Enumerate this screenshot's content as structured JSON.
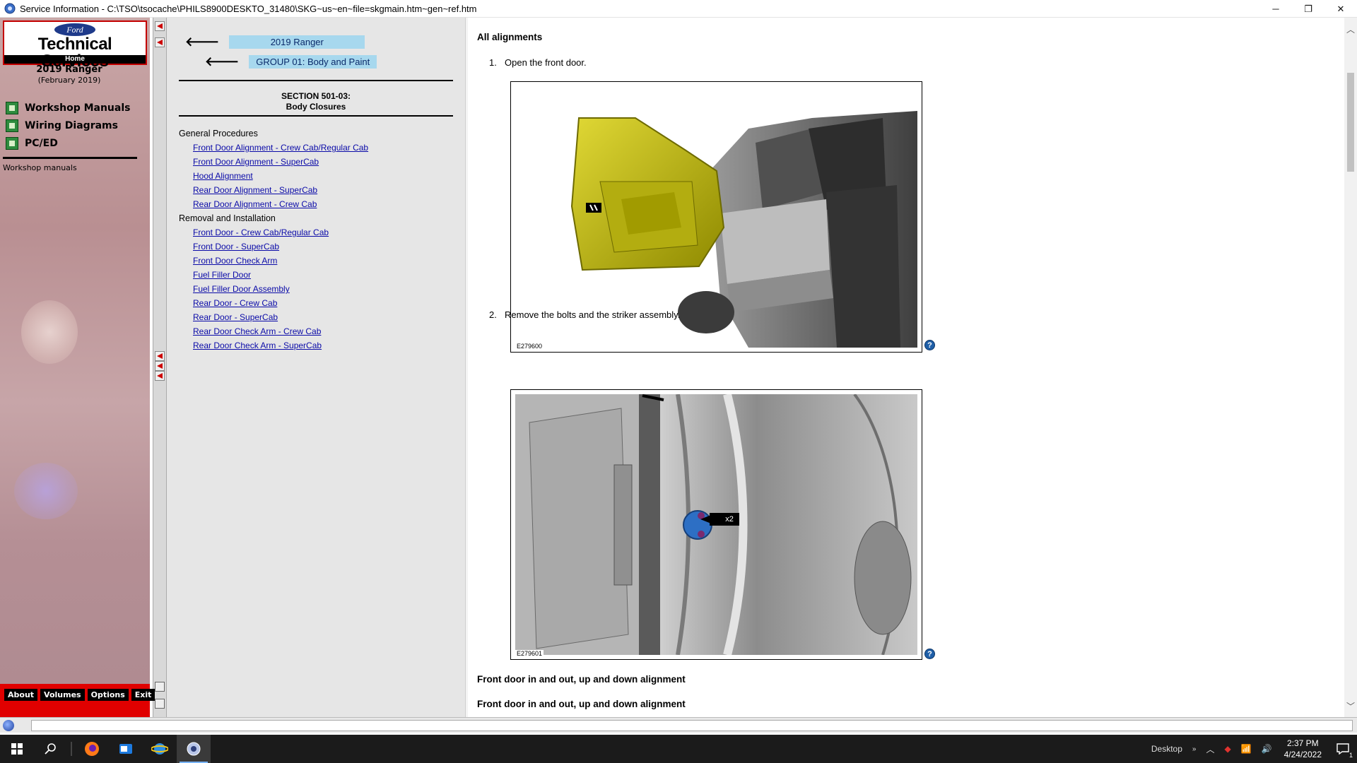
{
  "window": {
    "title": "Service Information - C:\\TSO\\tsocache\\PHILS8900DESKTO_31480\\SKG~us~en~file=skgmain.htm~gen~ref.htm",
    "minimize": "─",
    "restore": "❐",
    "close": "✕"
  },
  "sidebar": {
    "brand": {
      "logo_text": "Ford",
      "title": "Technical Services",
      "home": "Home"
    },
    "vehicle_name": "2019 Ranger",
    "vehicle_date": "(February 2019)",
    "nav_items": [
      {
        "label": "Workshop Manuals",
        "icon": "manual-icon"
      },
      {
        "label": "Wiring Diagrams",
        "icon": "wiring-icon"
      },
      {
        "label": "PC/ED",
        "icon": "pced-icon"
      }
    ],
    "caption": "Workshop manuals",
    "bottom_buttons": [
      "About",
      "Volumes",
      "Options",
      "Exit"
    ]
  },
  "toc": {
    "crumb_vehicle": "2019 Ranger",
    "crumb_group": "GROUP 01: Body and Paint",
    "section_code": "SECTION 501-03:",
    "section_name": "Body Closures",
    "categories": [
      {
        "name": "General Procedures",
        "links": [
          "Front Door Alignment - Crew Cab/Regular Cab",
          "Front Door Alignment - SuperCab",
          "Hood Alignment",
          "Rear Door Alignment - SuperCab",
          "Rear Door Alignment - Crew Cab"
        ]
      },
      {
        "name": "Removal and Installation",
        "links": [
          "Front Door - Crew Cab/Regular Cab",
          "Front Door - SuperCab",
          "Front Door Check Arm",
          "Fuel Filler Door",
          "Fuel Filler Door Assembly",
          "Rear Door - Crew Cab",
          "Rear Door - SuperCab",
          "Rear Door Check Arm - Crew Cab",
          "Rear Door Check Arm - SuperCab"
        ]
      }
    ]
  },
  "content": {
    "heading": "All alignments",
    "steps": [
      {
        "num": "1.",
        "text": "Open the front door.",
        "figure_id": "E279600"
      },
      {
        "num": "2.",
        "text": "Remove the bolts and the striker assembly.",
        "figure_id": "E279601",
        "callout": "x2"
      }
    ],
    "subheading_1": "Front door in and out, up and down alignment",
    "subheading_2": "Front door in and out, up and down alignment",
    "help_glyph": "?"
  },
  "taskbar": {
    "apps": [
      "start",
      "search",
      "firefox",
      "outlook",
      "ie",
      "service-info"
    ],
    "desktop_label": "Desktop",
    "time": "2:37 PM",
    "date": "4/24/2022",
    "notification_count": "1"
  },
  "colors": {
    "brand_red": "#c40000",
    "crumb_highlight": "#a7d8ee",
    "link": "#0a0aa8",
    "door_highlight": "#c9c200",
    "striker_blue": "#2d6fc4"
  }
}
